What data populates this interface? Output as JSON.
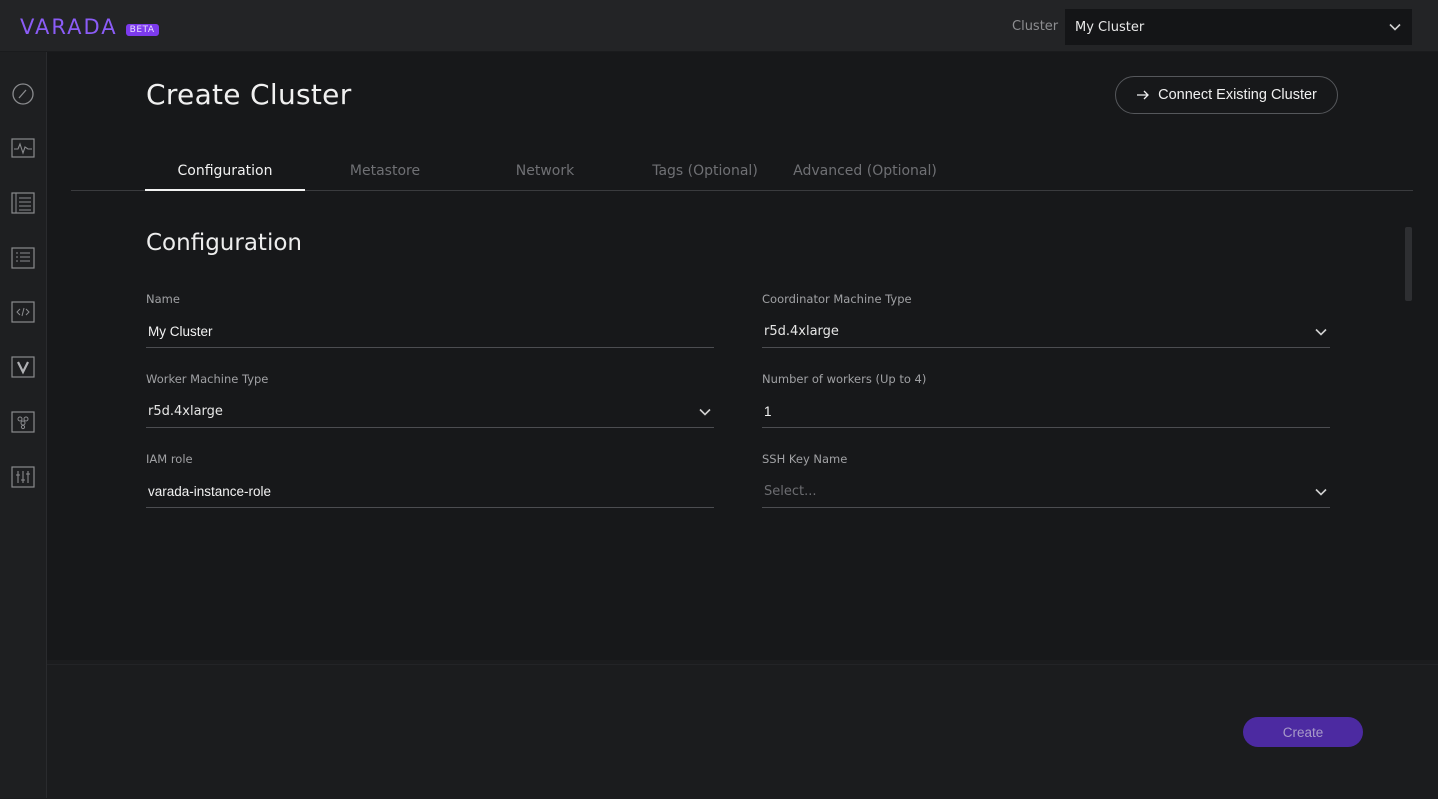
{
  "header": {
    "logo_text": "VARADA",
    "beta_label": "BETA",
    "cluster_label": "Cluster",
    "cluster_value": "My Cluster"
  },
  "sidebar": {
    "items": [
      {
        "icon": "dashboard-gauge-icon"
      },
      {
        "icon": "activity-monitor-icon"
      },
      {
        "icon": "table-list-icon"
      },
      {
        "icon": "list-icon"
      },
      {
        "icon": "code-icon"
      },
      {
        "icon": "varada-logo-icon"
      },
      {
        "icon": "grapes-icon"
      },
      {
        "icon": "sliders-icon"
      }
    ]
  },
  "page": {
    "title": "Create Cluster",
    "connect_button": "Connect Existing Cluster",
    "tabs": [
      {
        "label": "Configuration",
        "active": true
      },
      {
        "label": "Metastore",
        "active": false
      },
      {
        "label": "Network",
        "active": false
      },
      {
        "label": "Tags (Optional)",
        "active": false
      },
      {
        "label": "Advanced (Optional)",
        "active": false
      }
    ],
    "section_title": "Configuration"
  },
  "form": {
    "name": {
      "label": "Name",
      "value": "My Cluster"
    },
    "coordinator": {
      "label": "Coordinator Machine Type",
      "value": "r5d.4xlarge"
    },
    "worker": {
      "label": "Worker Machine Type",
      "value": "r5d.4xlarge"
    },
    "workers_count": {
      "label": "Number of workers (Up to 4)",
      "value": "1"
    },
    "iam_role": {
      "label": "IAM role",
      "value": "varada-instance-role"
    },
    "ssh_key": {
      "label": "SSH Key Name",
      "placeholder": "Select..."
    }
  },
  "footer": {
    "create_button": "Create"
  },
  "colors": {
    "accent": "#7c3aed",
    "create_button": "#4c2aa1",
    "background": "#17181a"
  }
}
